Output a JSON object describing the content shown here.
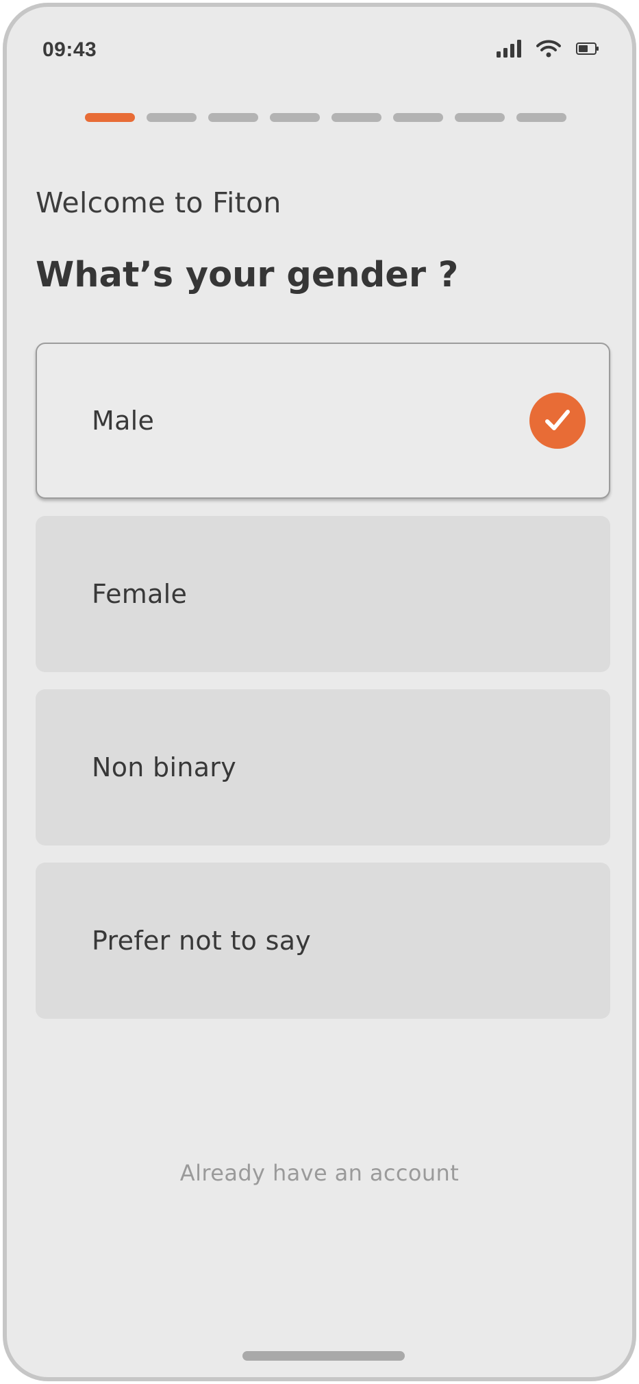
{
  "status_bar": {
    "time": "09:43",
    "icons": [
      "signal-icon",
      "wifi-icon",
      "battery-icon"
    ]
  },
  "progress": {
    "total_steps": 8,
    "current_step": 1,
    "active_color": "#e86c36",
    "inactive_color": "#b3b3b3"
  },
  "header": {
    "welcome": "Welcome to Fiton",
    "question": "What’s your gender ?"
  },
  "options": [
    {
      "label": "Male",
      "selected": true
    },
    {
      "label": "Female",
      "selected": false
    },
    {
      "label": "Non binary",
      "selected": false
    },
    {
      "label": "Prefer not to say",
      "selected": false
    }
  ],
  "footer": {
    "login_link": "Already have an account"
  },
  "colors": {
    "accent": "#e86c36",
    "background": "#eaeaea",
    "option_bg": "#dcdcdc"
  }
}
